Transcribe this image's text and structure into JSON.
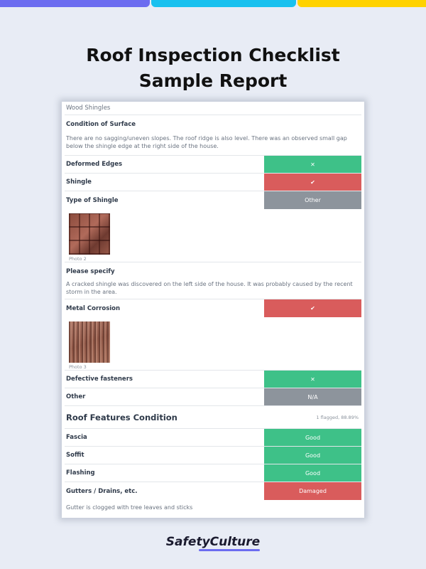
{
  "header": {
    "title_line1": "Roof Inspection Checklist",
    "title_line2": "Sample Report"
  },
  "report": {
    "section_label": "Wood Shingles",
    "condition_of_surface": {
      "label": "Condition of Surface",
      "note": "There are no sagging/uneven slopes. The roof ridge is also level. There was an observed small gap below the shingle edge at the right side of the house."
    },
    "items": [
      {
        "label": "Deformed Edges",
        "response": "✕",
        "color": "green"
      },
      {
        "label": "Shingle",
        "response": "✔",
        "color": "red"
      },
      {
        "label": "Type of Shingle",
        "response": "Other",
        "color": "grey"
      }
    ],
    "photo2_caption": "Photo 2",
    "please_specify": {
      "label": "Please specify",
      "note": "A cracked shingle was discovered on the left side of the house. It was probably caused by the recent storm in the area."
    },
    "metal_corrosion": {
      "label": "Metal Corrosion",
      "response": "✔",
      "color": "red"
    },
    "photo3_caption": "Photo 3",
    "items2": [
      {
        "label": "Defective fasteners",
        "response": "✕",
        "color": "green"
      },
      {
        "label": "Other",
        "response": "N/A",
        "color": "grey"
      }
    ],
    "features": {
      "title": "Roof Features Condition",
      "meta": "1 flagged, 88.89%",
      "items": [
        {
          "label": "Fascia",
          "response": "Good",
          "color": "green"
        },
        {
          "label": "Soffit",
          "response": "Good",
          "color": "green"
        },
        {
          "label": "Flashing",
          "response": "Good",
          "color": "green"
        },
        {
          "label": "Gutters / Drains, etc.",
          "response": "Damaged",
          "color": "red"
        }
      ],
      "gutter_note": "Gutter is clogged with tree leaves and sticks"
    }
  },
  "footer": {
    "brand": "SafetyCulture"
  },
  "colors": {
    "green": "#3ec188",
    "red": "#d95c5c",
    "grey": "#8d949c",
    "accent_purple": "#6c6cf0",
    "accent_blue": "#19c1ef",
    "accent_yellow": "#ffd200"
  }
}
